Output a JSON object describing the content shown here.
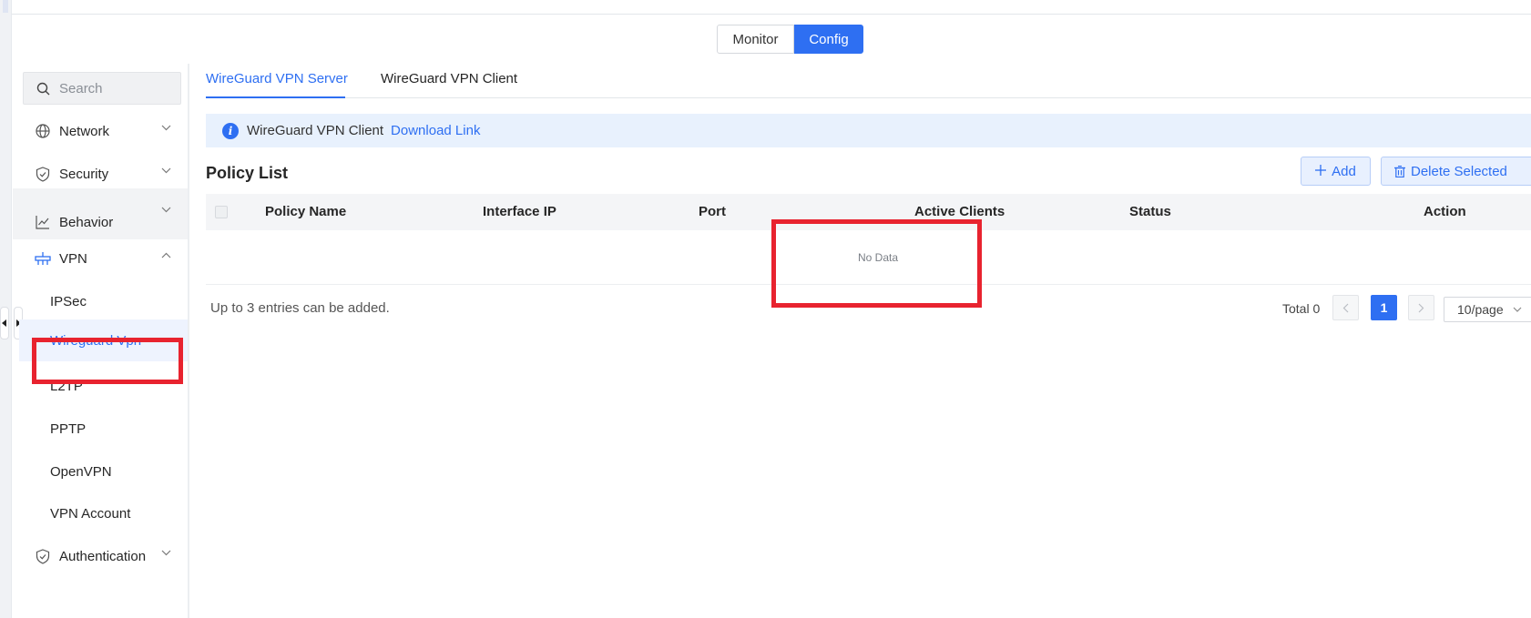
{
  "mode_switch": {
    "monitor": "Monitor",
    "config": "Config"
  },
  "sidebar": {
    "search_placeholder": "Search",
    "groups": [
      {
        "label": "Network",
        "icon": "globe-icon"
      },
      {
        "label": "Security",
        "icon": "shield-icon"
      },
      {
        "label": "Behavior",
        "icon": "line-chart-icon"
      },
      {
        "label": "VPN",
        "icon": "vpn-icon",
        "expanded": true
      },
      {
        "label": "Authentication",
        "icon": "shield-check-icon"
      }
    ],
    "vpn_items": [
      "IPSec",
      "Wireguard Vpn",
      "L2TP",
      "PPTP",
      "OpenVPN",
      "VPN Account"
    ],
    "active_item": "Wireguard Vpn"
  },
  "tabs": [
    "WireGuard VPN Server",
    "WireGuard VPN Client"
  ],
  "info": {
    "text": "WireGuard VPN Client",
    "link": "Download Link",
    "icon": "info-icon"
  },
  "policy": {
    "title": "Policy List",
    "add_label": "Add",
    "delete_label": "Delete Selected",
    "columns": [
      "Policy Name",
      "Interface IP",
      "Port",
      "Active Clients",
      "Status",
      "Action"
    ],
    "rows": [],
    "empty_text": "No Data",
    "note": "Up to 3 entries can be added."
  },
  "pagination": {
    "total_label": "Total 0",
    "current_page": "1",
    "page_size": "10/page"
  },
  "colors": {
    "accent": "#2e6ff2",
    "highlight": "#e8232f",
    "info_bg": "#e8f1fd"
  }
}
